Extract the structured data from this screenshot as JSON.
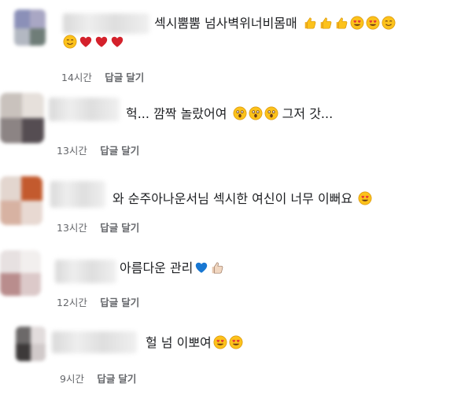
{
  "comments": [
    {
      "text": "섹시뿜뿜 넘사벽위너비몸매",
      "time": "14시간",
      "like": "답글",
      "reply": "달기",
      "emojis_line1": [
        "thumbs-up",
        "thumbs-up",
        "thumbs-up",
        "heart-eyes",
        "heart-eyes",
        "smiling-hug"
      ],
      "emojis_line2": [
        "smiling-hug",
        "red-heart",
        "red-heart",
        "red-heart"
      ]
    },
    {
      "text": "헉... 깜짝 놀랐어여",
      "text_after": "그저 갓...",
      "time": "13시간",
      "like": "답글",
      "reply": "달기",
      "emojis": [
        "astonished",
        "astonished",
        "astonished"
      ]
    },
    {
      "text": "와 순주아나운서님 섹시한 여신이 너무 이뻐요",
      "time": "13시간",
      "like": "답글",
      "reply": "달기",
      "emojis": [
        "heart-eyes"
      ]
    },
    {
      "text": "아름다운 관리",
      "time": "12시간",
      "like": "답글",
      "reply": "달기",
      "emojis": [
        "blue-heart",
        "thumbs-up-light"
      ]
    },
    {
      "text": "헐 넘 이뽀여",
      "time": "9시간",
      "like": "답글",
      "reply": "달기",
      "emojis": [
        "heart-eyes",
        "heart-eyes"
      ]
    }
  ]
}
